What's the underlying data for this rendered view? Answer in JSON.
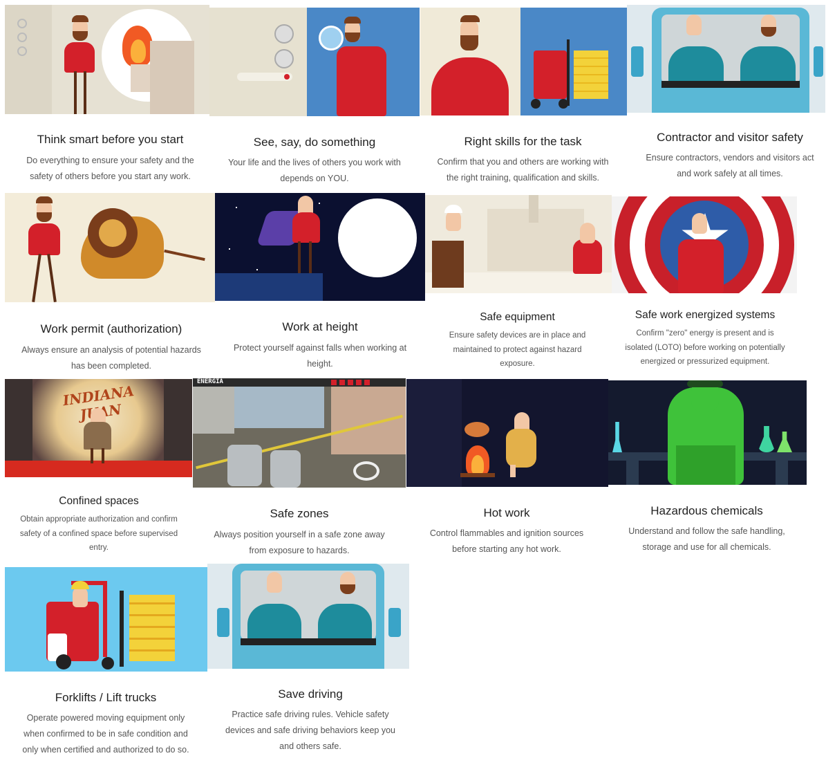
{
  "cards": [
    {
      "title": "Think smart before you start",
      "desc": [
        "Do everything to ensure your safety and the",
        "safety of others before you start any work."
      ]
    },
    {
      "title": "See, say, do something",
      "desc": [
        "Your life and the lives of others you work with",
        "depends on YOU."
      ]
    },
    {
      "title": "Right skills for the task",
      "desc": [
        "Confirm that you and others are working with",
        "the right training, qualification and skills."
      ]
    },
    {
      "title": "Contractor and visitor safety",
      "desc": [
        "Ensure contractors, vendors and visitors act",
        "and work safely at all times."
      ]
    },
    {
      "title": "Work permit (authorization)",
      "desc": [
        "Always ensure an analysis of potential hazards",
        "has been completed."
      ]
    },
    {
      "title": "Work at height",
      "desc": [
        "Protect yourself against falls when working at",
        "height."
      ]
    },
    {
      "title": "Safe equipment",
      "desc": [
        "Ensure safety devices are in place and",
        "maintained to protect against hazard",
        "exposure."
      ]
    },
    {
      "title": "Safe work energized systems",
      "desc": [
        "Confirm \"zero\" energy is present and is",
        "isolated (LOTO) before working on potentially",
        "energized or pressurized equipment."
      ]
    },
    {
      "title": "Confined spaces",
      "desc": [
        "Obtain appropriate authorization and confirm",
        "safety of a confined space before supervised",
        "entry."
      ]
    },
    {
      "title": "Safe zones",
      "desc": [
        "Always position yourself in a safe zone away",
        "from exposure to hazards."
      ]
    },
    {
      "title": "Hot work",
      "desc": [
        "Control flammables and ignition sources",
        "before starting any hot work."
      ]
    },
    {
      "title": "Hazardous chemicals",
      "desc": [
        "Understand and follow the safe handling,",
        "storage and use for all chemicals."
      ]
    },
    {
      "title": "Forklifts / Lift trucks",
      "desc": [
        "Operate powered moving equipment only",
        "when confirmed to be in safe condition and",
        "only when certified and authorized to do so."
      ]
    },
    {
      "title": "Save driving",
      "desc": [
        "Practice safe driving rules. Vehicle safety",
        "devices and safe driving behaviors keep you",
        "and others safe."
      ]
    }
  ],
  "illustration_text": {
    "indiana_logo": "INDIANA JUAN",
    "energia_label": "ENERGIA"
  },
  "colors": {
    "shirt_red": "#d3202a",
    "sky_blue": "#6cc9ef",
    "steel_blue": "#4a88c7",
    "night": "#0b1030",
    "cream": "#ece6d6"
  },
  "icons": [
    "fire-icon",
    "magnifier-icon",
    "forklift-icon",
    "truck-cab-icon",
    "lion-icon",
    "superhero-icon",
    "moon-icon",
    "factory-icon",
    "shield-star-icon",
    "cave-icon",
    "city-isometric-icon",
    "campfire-icon",
    "chemistry-flask-icon"
  ]
}
